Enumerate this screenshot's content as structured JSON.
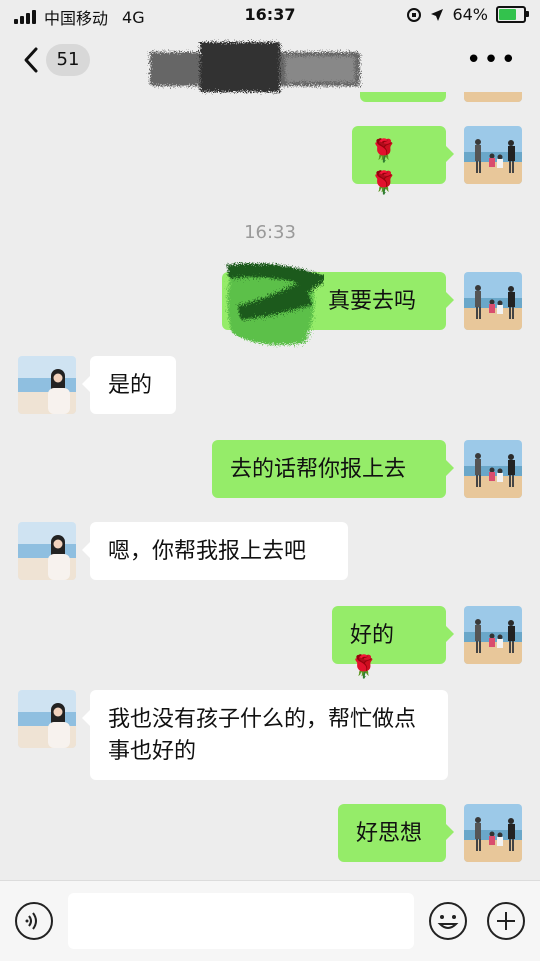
{
  "status_bar": {
    "carrier": "中国移动",
    "network": "4G",
    "time": "16:37",
    "battery": "64%",
    "battery_level": 0.64
  },
  "nav": {
    "unread_count": "51"
  },
  "chat": {
    "timestamp": "16:33",
    "messages": [
      {
        "side": "me",
        "text": ""
      },
      {
        "side": "me",
        "text": "🌹 🌹"
      },
      {
        "side": "me",
        "text": "真要去吗"
      },
      {
        "side": "them",
        "text": "是的"
      },
      {
        "side": "me",
        "text": "去的话帮你报上去"
      },
      {
        "side": "them",
        "text": "嗯，你帮我报上去吧"
      },
      {
        "side": "me",
        "text": "好的 🌹"
      },
      {
        "side": "them",
        "text": "我也没有孩子什么的，帮忙做点事也好的"
      },
      {
        "side": "me",
        "text": "好思想"
      }
    ]
  },
  "colors": {
    "my_bubble": "#95ec69",
    "their_bubble": "#ffffff",
    "background": "#ededed",
    "battery_fill": "#33c24d"
  },
  "icons": {
    "back": "chevron-left-icon",
    "more": "more-dots-icon",
    "voice": "voice-icon",
    "emoji": "emoji-icon",
    "add": "plus-circle-icon"
  }
}
